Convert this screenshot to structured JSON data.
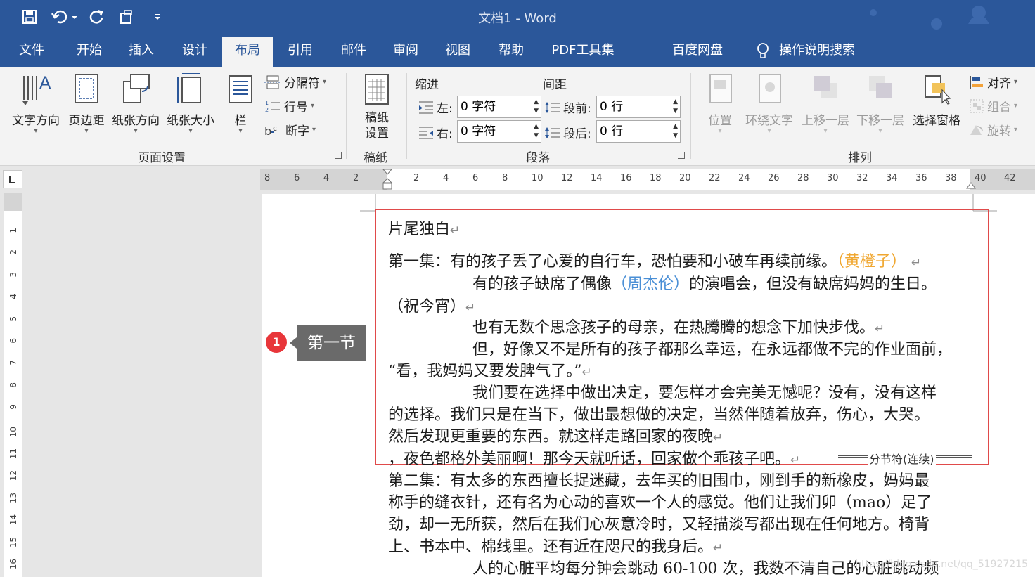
{
  "titlebar": {
    "doc_title": "文档1  -  Word"
  },
  "tabs": [
    "文件",
    "开始",
    "插入",
    "设计",
    "布局",
    "引用",
    "邮件",
    "审阅",
    "视图",
    "帮助",
    "PDF工具集",
    "百度网盘",
    "操作说明搜索"
  ],
  "active_tab": "布局",
  "ribbon": {
    "page_setup": {
      "text_direction": "文字方向",
      "margins": "页边距",
      "orientation": "纸张方向",
      "size": "纸张大小",
      "columns": "栏",
      "breaks": "分隔符",
      "line_numbers": "行号",
      "hyphenation": "断字",
      "group_label": "页面设置"
    },
    "manuscript": {
      "settings_line1": "稿纸",
      "settings_line2": "设置",
      "group_label": "稿纸"
    },
    "paragraph": {
      "indent_title": "缩进",
      "spacing_title": "间距",
      "left_label": "左:",
      "right_label": "右:",
      "before_label": "段前:",
      "after_label": "段后:",
      "left_value": "0 字符",
      "right_value": "0 字符",
      "before_value": "0 行",
      "after_value": "0 行",
      "group_label": "段落"
    },
    "arrange": {
      "position": "位置",
      "wrap_text": "环绕文字",
      "bring_forward": "上移一层",
      "send_backward": "下移一层",
      "selection_pane": "选择窗格",
      "align": "对齐",
      "group": "组合",
      "rotate": "旋转",
      "group_label": "排列"
    }
  },
  "ruler": {
    "left_ticks": [
      "8",
      "6",
      "4",
      "2"
    ],
    "right_ticks": [
      "2",
      "4",
      "6",
      "8",
      "10",
      "12",
      "14",
      "16",
      "18",
      "20",
      "22",
      "24",
      "26",
      "28",
      "30",
      "32",
      "34",
      "36",
      "38",
      "40",
      "42"
    ],
    "vertical_ticks": [
      "1",
      "2",
      "3",
      "4",
      "5",
      "6",
      "7",
      "8",
      "9",
      "10",
      "11",
      "12",
      "13",
      "14",
      "15",
      "16"
    ]
  },
  "annotation": {
    "badge": "1",
    "callout": "第一节"
  },
  "document": {
    "title": "片尾独白",
    "p1_text": "第一集：有的孩子丢了心爱的自行车，恐怕要和小破车再续前缘。",
    "p1_credit": "（黄橙子）",
    "p2_text_a": "有的孩子缺席了偶像",
    "p2_credit": "（周杰伦）",
    "p2_text_b": "的演唱会，但没有缺席妈妈的生日。",
    "p2_line2": "（祝今宵）",
    "p3": "也有无数个思念孩子的母亲，在热腾腾的想念下加快步伐。",
    "p4_line1": "但，好像又不是所有的孩子都那么幸运，在永远都做不完的作业面前，",
    "p4_line2": "“看，我妈妈又要发脾气了。”",
    "p5_line1": "我们要在选择中做出决定，要怎样才会完美无憾呢？没有，没有这样",
    "p5_line2": "的选择。我们只是在当下，做出最想做的决定，当然伴随着放弃，伤心，大哭。",
    "p5_line3": "然后发现更重要的东西。就这样走路回家的夜晚",
    "p6": "，夜色都格外美丽啊！那今天就听话，回家做个乖孩子吧。",
    "section_break": "分节符(连续)",
    "p7_line1": "第二集：有太多的东西擅长捉迷藏，去年买的旧围巾，刚到手的新橡皮，妈妈最",
    "p7_line2": "称手的缝衣针，还有名为心动的喜欢一个人的感觉。他们让我们卯（mao）足了",
    "p7_line3": "劲，却一无所获，然后在我们心灰意冷时，又轻描淡写都出现在任何地方。椅背",
    "p7_line4": "上、书本中、棉线里。还有近在咫尺的我身后。",
    "p8": "人的心脏平均每分钟会跳动 60-100 次，我数不清自己的心脏跳动频",
    "return_mark": "↵"
  },
  "watermark": "https://blog.csdn.net/qq_51927215"
}
